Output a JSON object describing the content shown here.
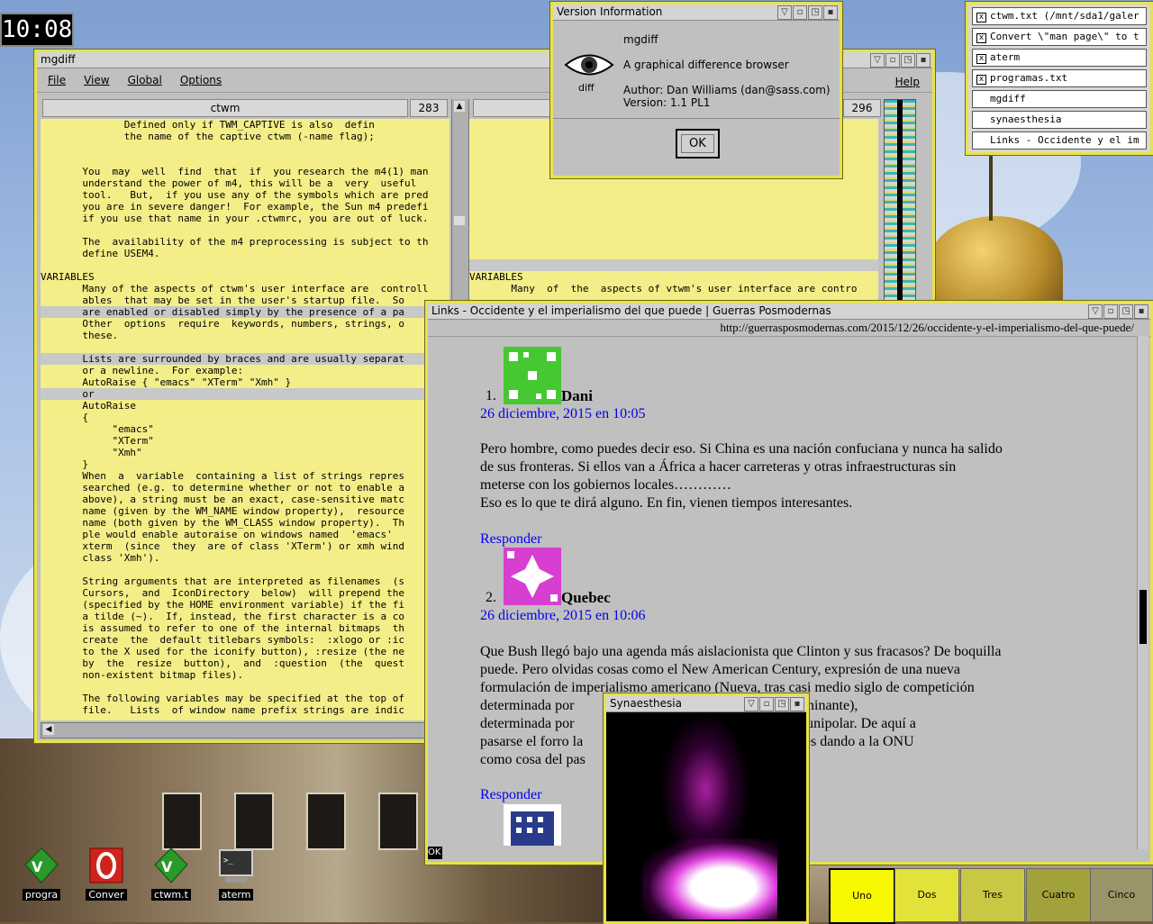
{
  "clock": {
    "time": "10:08"
  },
  "mgdiff": {
    "title": "mgdiff",
    "menus": [
      "File",
      "View",
      "Global",
      "Options"
    ],
    "help": "Help",
    "left_file": "ctwm",
    "left_lines": "283",
    "right_lines": "296",
    "left_text": [
      "              Defined only if TWM_CAPTIVE is also  defin",
      "              the name of the captive ctwm (-name flag);",
      "",
      "",
      "       You  may  well  find  that  if  you research the m4(1) man",
      "       understand the power of m4, this will be a  very  useful",
      "       tool.   But,  if you use any of the symbols which are pred",
      "       you are in severe danger!  For example, the Sun m4 predefi",
      "       if you use that name in your .ctwmrc, you are out of luck.",
      "",
      "       The  availability of the m4 preprocessing is subject to th",
      "       define USEM4.",
      "",
      "VARIABLES",
      "       Many of the aspects of ctwm's user interface are  controll",
      "       ables  that may be set in the user's startup file.  So",
      "       are enabled or disabled simply by the presence of a pa",
      "       Other  options  require  keywords, numbers, strings, o",
      "       these.",
      "",
      "       Lists are surrounded by braces and are usually separat",
      "       or a newline.  For example:",
      "       AutoRaise { \"emacs\" \"XTerm\" \"Xmh\" }",
      "       or",
      "       AutoRaise",
      "       {",
      "            \"emacs\"",
      "            \"XTerm\"",
      "            \"Xmh\"",
      "       }",
      "       When  a  variable  containing a list of strings repres",
      "       searched (e.g. to determine whether or not to enable a",
      "       above), a string must be an exact, case-sensitive matc",
      "       name (given by the WM_NAME window property),  resource",
      "       name (both given by the WM_CLASS window property).  Th",
      "       ple would enable autoraise on windows named  'emacs'",
      "       xterm  (since  they  are of class 'XTerm') or xmh wind",
      "       class 'Xmh').",
      "",
      "       String arguments that are interpreted as filenames  (s",
      "       Cursors,  and  IconDirectory  below)  will prepend the",
      "       (specified by the HOME environment variable) if the fi",
      "       a tilde (~).  If, instead, the first character is a co",
      "       is assumed to refer to one of the internal bitmaps  th",
      "       create  the  default titlebars symbols:  :xlogo or :ic",
      "       to the X used for the iconify button), :resize (the ne",
      "       by  the  resize  button),  and  :question  (the  quest",
      "       non-existent bitmap files).",
      "",
      "       The following variables may be specified at the top of",
      "       file.   Lists  of window name prefix strings are indic"
    ],
    "right_text": [
      "VARIABLES",
      "       Many  of  the  aspects of vtwm's user interface are contro"
    ]
  },
  "version_dialog": {
    "title": "Version Information",
    "app": "mgdiff",
    "desc": "A graphical difference browser",
    "author": "Author: Dan Williams (dan@sass.com)",
    "version": "Version: 1.1 PL1",
    "ok": "OK",
    "icon_label": "diff"
  },
  "window_list": [
    {
      "label": "ctwm.txt (/mnt/sda1/galer",
      "checked": true
    },
    {
      "label": "Convert \\\"man page\\\" to t",
      "checked": true
    },
    {
      "label": "aterm",
      "checked": true
    },
    {
      "label": "programas.txt",
      "checked": true
    },
    {
      "label": "mgdiff",
      "checked": false
    },
    {
      "label": "synaesthesia",
      "checked": false
    },
    {
      "label": "Links - Occidente y el im",
      "checked": false
    }
  ],
  "links": {
    "title": "Links - Occidente y el imperialismo del que puede | Guerras Posmodernas",
    "url": "http://guerrasposmodernas.com/2015/12/26/occidente-y-el-imperialismo-del-que-puede/",
    "status": "OK",
    "comments": [
      {
        "num": "1.",
        "author": "Dani",
        "date": "26 diciembre, 2015 en 10:05",
        "text": [
          "Pero hombre, como puedes decir eso. Si China es una nación confuciana y nunca ha salido",
          "de sus fronteras. Si ellos van a África a hacer carreteras y otras infraestructuras sin",
          "meterse con los gobiernos locales…………",
          "Eso es lo que te dirá alguno. En fin, vienen tiempos interesantes."
        ],
        "reply": "Responder"
      },
      {
        "num": "2.",
        "author": "Quebec",
        "date": "26 diciembre, 2015 en 10:06",
        "text": [
          "Que Bush llegó bajo una agenda más aislacionista que Clinton y sus fracasos? De boquilla",
          "puede. Pero olvidas cosas como el New American Century, expresión de una nueva",
          "formulación de imperialismo americano (Nueva, tras casi medio siglo de competición",
          "determinada por                          intención fue la idea dominante),",
          "determinada por                          perioridad y del mundo unipolar. De aquí a",
          "pasarse el forro la                      intervenciones unilaterales dando a la ONU",
          "como cosa del pas"
        ],
        "reply": "Responder"
      }
    ]
  },
  "synaesthesia": {
    "title": "Synaesthesia"
  },
  "desktop_icons": [
    {
      "label": "progra",
      "icon": "vim-icon"
    },
    {
      "label": "Conver",
      "icon": "opera-icon"
    },
    {
      "label": "ctwm.t",
      "icon": "vim-icon"
    },
    {
      "label": "aterm",
      "icon": "terminal-icon"
    }
  ],
  "pager": [
    "Uno",
    "Dos",
    "Tres",
    "Cuatro",
    "Cinco"
  ],
  "colors": {
    "frame": "#e8e34a",
    "pane": "#f3ee88",
    "link": "#0000ee"
  }
}
